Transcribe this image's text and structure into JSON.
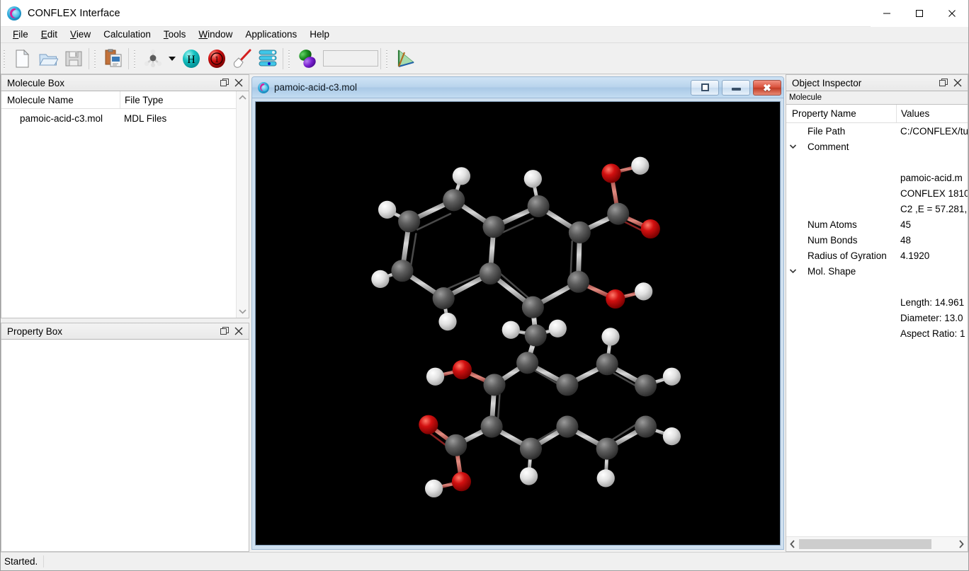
{
  "window": {
    "title": "CONFLEX Interface",
    "logo_icon": "conflex-logo-icon",
    "minimize_label": "Minimize",
    "maximize_label": "Maximize",
    "close_label": "Close"
  },
  "menubar": {
    "items": [
      {
        "label": "File",
        "accel": "F"
      },
      {
        "label": "Edit",
        "accel": "E"
      },
      {
        "label": "View",
        "accel": "V"
      },
      {
        "label": "Calculation",
        "accel": ""
      },
      {
        "label": "Tools",
        "accel": "T"
      },
      {
        "label": "Window",
        "accel": "W"
      },
      {
        "label": "Applications",
        "accel": ""
      },
      {
        "label": "Help",
        "accel": ""
      }
    ]
  },
  "toolbar": {
    "buttons": [
      {
        "name": "new-file-button",
        "icon": "new-document-icon",
        "tooltip": "New"
      },
      {
        "name": "open-file-button",
        "icon": "open-folder-icon",
        "tooltip": "Open"
      },
      {
        "name": "save-file-button",
        "icon": "floppy-save-icon",
        "tooltip": "Save"
      },
      {
        "name": "import-button",
        "icon": "import-clipboard-icon",
        "tooltip": "Import"
      },
      {
        "name": "build-molecule-button",
        "icon": "methane-model-icon",
        "tooltip": "Build Molecule"
      },
      {
        "name": "build-dropdown-button",
        "icon": "chevron-down-icon",
        "tooltip": "More"
      },
      {
        "name": "add-hydrogen-button",
        "icon": "hydrogen-sphere-icon",
        "tooltip": "Add Hydrogen"
      },
      {
        "name": "bond-order-button",
        "icon": "bond-order-sphere-icon",
        "tooltip": "Bond Order"
      },
      {
        "name": "clean-structure-button",
        "icon": "magic-wand-icon",
        "tooltip": "Clean"
      },
      {
        "name": "conformation-list-button",
        "icon": "stacked-list-icon",
        "tooltip": "Conformations"
      },
      {
        "name": "orbital-button",
        "icon": "orbital-lobes-icon",
        "tooltip": "Orbitals"
      },
      {
        "name": "orbital-combo",
        "icon": "combo-box",
        "tooltip": "Orbital selection"
      },
      {
        "name": "axes-button",
        "icon": "axes-tripod-icon",
        "tooltip": "Axes"
      }
    ],
    "combo_value": ""
  },
  "molecule_box": {
    "title": "Molecule Box",
    "float_icon": "restore-window-icon",
    "close_icon": "close-icon",
    "columns": [
      "Molecule Name",
      "File Type"
    ],
    "rows": [
      {
        "name": "pamoic-acid-c3.mol",
        "file_type": "MDL Files"
      }
    ]
  },
  "property_box": {
    "title": "Property Box",
    "float_icon": "restore-window-icon",
    "close_icon": "close-icon",
    "content": ""
  },
  "mdi": {
    "title": "pamoic-acid-c3.mol",
    "logo_icon": "conflex-logo-icon",
    "restore_label": "Restore",
    "minimize_label": "Minimize",
    "close_label": "Close",
    "viewport_background": "#000000"
  },
  "object_inspector": {
    "title": "Object Inspector",
    "float_icon": "restore-window-icon",
    "close_icon": "close-icon",
    "subject": "Molecule",
    "columns": [
      "Property Name",
      "Values"
    ],
    "rows": [
      {
        "label": "File Path",
        "value": "C:/CONFLEX/tu",
        "twisty": "",
        "indent": 1
      },
      {
        "label": "Comment",
        "value": "",
        "twisty": "expanded",
        "indent": 0
      },
      {
        "label": "",
        "value": "",
        "twisty": "",
        "indent": 1
      },
      {
        "label": "",
        "value": "pamoic-acid.m",
        "twisty": "",
        "indent": 1
      },
      {
        "label": "",
        "value": "CONFLEX 1810",
        "twisty": "",
        "indent": 1
      },
      {
        "label": "",
        "value": "C2 ,E = 57.281,",
        "twisty": "",
        "indent": 1
      },
      {
        "label": "Num Atoms",
        "value": "45",
        "twisty": "",
        "indent": 1
      },
      {
        "label": "Num Bonds",
        "value": "48",
        "twisty": "",
        "indent": 1
      },
      {
        "label": "Radius of Gyration",
        "value": "4.1920",
        "twisty": "",
        "indent": 1
      },
      {
        "label": "Mol. Shape",
        "value": "",
        "twisty": "expanded",
        "indent": 0
      },
      {
        "label": "",
        "value": "",
        "twisty": "",
        "indent": 1
      },
      {
        "label": "",
        "value": "Length: 14.961",
        "twisty": "",
        "indent": 1
      },
      {
        "label": "",
        "value": "Diameter: 13.0",
        "twisty": "",
        "indent": 1
      },
      {
        "label": "",
        "value": "Aspect Ratio: 1",
        "twisty": "",
        "indent": 1
      }
    ],
    "hscroll_left_icon": "chevron-left-icon",
    "hscroll_right_icon": "chevron-right-icon"
  },
  "statusbar": {
    "message": "Started."
  },
  "colors": {
    "accent_titlebar": "#b9d4ec",
    "viewport_bg": "#000000",
    "atom_carbon": "#505050",
    "atom_oxygen": "#cc0000",
    "atom_hydrogen": "#ffffff",
    "close_button_red": "#d9503a"
  },
  "molecule_render": {
    "name": "pamoic-acid-c3",
    "style": "ball-and-stick",
    "atom_legend": [
      {
        "element": "C",
        "color": "#505050"
      },
      {
        "element": "O",
        "color": "#cc0000"
      },
      {
        "element": "H",
        "color": "#ffffff"
      }
    ]
  }
}
